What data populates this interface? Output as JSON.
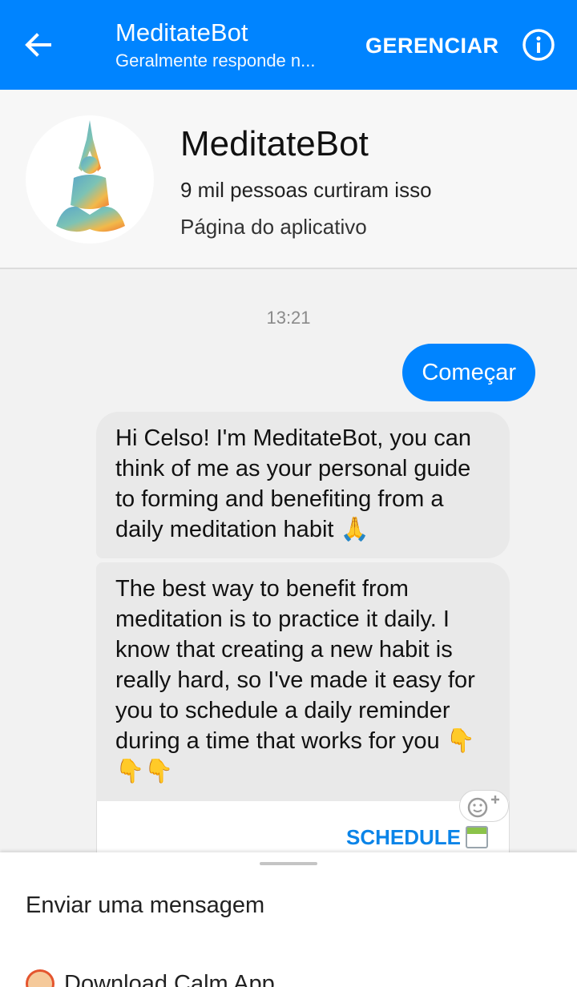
{
  "header": {
    "title": "MeditateBot",
    "subtitle": "Geralmente responde n...",
    "manage_label": "GERENCIAR",
    "back_icon": "arrow-left-icon",
    "info_icon": "info-icon"
  },
  "profile": {
    "name": "MeditateBot",
    "likes": "9 mil pessoas curtiram isso",
    "type": "Página do aplicativo"
  },
  "chat": {
    "timestamp": "13:21",
    "outgoing": "Começar",
    "incoming": [
      "Hi Celso! I'm MeditateBot, you can think of me as your personal guide to forming and benefiting from a daily meditation habit 🙏",
      "The best way to benefit from meditation is to practice it daily. I know that creating a new habit is really hard, so I've made it easy for you to schedule a daily reminder during a time that works for you 👇👇👇"
    ],
    "button_label": "SCHEDULE"
  },
  "composer": {
    "placeholder": "Enviar uma mensagem",
    "menu_item": "Download Calm App"
  },
  "colors": {
    "accent": "#0084ff",
    "bubble_in": "#e9e9e9",
    "button_text": "#0a84e8"
  }
}
